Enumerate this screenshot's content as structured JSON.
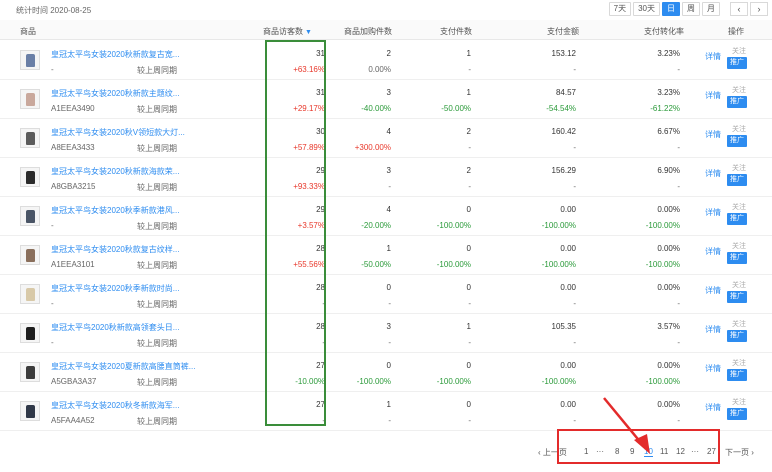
{
  "header": {
    "stat_time": "统计时间 2020-08-25",
    "ranges": [
      "7天",
      "30天",
      "日",
      "周",
      "月"
    ],
    "active_range": "日",
    "prev_arrow": "‹",
    "next_arrow": "›"
  },
  "columns": {
    "product": "商品",
    "visitors": "商品访客数",
    "cart": "商品加购件数",
    "pay_count": "支付件数",
    "pay_amount": "支付金额",
    "conversion": "支付转化率",
    "actions": "操作"
  },
  "compare_label": "较上周同期",
  "action_labels": {
    "detail": "详情",
    "follow": "关注",
    "promote": "推广"
  },
  "rows": [
    {
      "title": "皇冠太平鸟女装2020秋新款复古宽...",
      "code": "-",
      "visitors": "31",
      "visitors_chg": "+63.16%",
      "cart": "2",
      "cart_chg": "0.00%",
      "pay_count": "1",
      "pay_count_chg": "-",
      "pay_amount": "153.12",
      "pay_amount_chg": "-",
      "conversion": "3.23%",
      "conversion_chg": "-",
      "thumb_color": "#6a7fa6"
    },
    {
      "title": "皇冠太平鸟女装2020秋新款主题纹...",
      "code": "A1EEA3490",
      "visitors": "31",
      "visitors_chg": "+29.17%",
      "cart": "3",
      "cart_chg": "-40.00%",
      "pay_count": "1",
      "pay_count_chg": "-50.00%",
      "pay_amount": "84.57",
      "pay_amount_chg": "-54.54%",
      "conversion": "3.23%",
      "conversion_chg": "-61.22%",
      "thumb_color": "#c9a89c"
    },
    {
      "title": "皇冠太平鸟女装2020秋V领短款大灯...",
      "code": "A8EEA3433",
      "visitors": "30",
      "visitors_chg": "+57.89%",
      "cart": "4",
      "cart_chg": "+300.00%",
      "pay_count": "2",
      "pay_count_chg": "-",
      "pay_amount": "160.42",
      "pay_amount_chg": "-",
      "conversion": "6.67%",
      "conversion_chg": "-",
      "thumb_color": "#5b5b5b"
    },
    {
      "title": "皇冠太平鸟女装2020秋新款海款荣...",
      "code": "A8GBA3215",
      "visitors": "29",
      "visitors_chg": "+93.33%",
      "cart": "3",
      "cart_chg": "-",
      "pay_count": "2",
      "pay_count_chg": "-",
      "pay_amount": "156.29",
      "pay_amount_chg": "-",
      "conversion": "6.90%",
      "conversion_chg": "-",
      "thumb_color": "#2b2b2b"
    },
    {
      "title": "皇冠太平鸟女装2020秋季新款港风...",
      "code": "-",
      "visitors": "29",
      "visitors_chg": "+3.57%",
      "cart": "4",
      "cart_chg": "-20.00%",
      "pay_count": "0",
      "pay_count_chg": "-100.00%",
      "pay_amount": "0.00",
      "pay_amount_chg": "-100.00%",
      "conversion": "0.00%",
      "conversion_chg": "-100.00%",
      "thumb_color": "#4a5566"
    },
    {
      "title": "皇冠太平鸟女装2020秋款复古纹样...",
      "code": "A1EEA3101",
      "visitors": "28",
      "visitors_chg": "+55.56%",
      "cart": "1",
      "cart_chg": "-50.00%",
      "pay_count": "0",
      "pay_count_chg": "-100.00%",
      "pay_amount": "0.00",
      "pay_amount_chg": "-100.00%",
      "conversion": "0.00%",
      "conversion_chg": "-100.00%",
      "thumb_color": "#8a6f5c"
    },
    {
      "title": "皇冠太平鸟女装2020秋季新款时尚...",
      "code": "-",
      "visitors": "28",
      "visitors_chg": "-",
      "cart": "0",
      "cart_chg": "-",
      "pay_count": "0",
      "pay_count_chg": "-",
      "pay_amount": "0.00",
      "pay_amount_chg": "-",
      "conversion": "0.00%",
      "conversion_chg": "-",
      "thumb_color": "#d8c9a8"
    },
    {
      "title": "皇冠太平鸟2020秋新款高领套头日...",
      "code": "-",
      "visitors": "28",
      "visitors_chg": "-",
      "cart": "3",
      "cart_chg": "-",
      "pay_count": "1",
      "pay_count_chg": "-",
      "pay_amount": "105.35",
      "pay_amount_chg": "-",
      "conversion": "3.57%",
      "conversion_chg": "-",
      "thumb_color": "#1e1e1e"
    },
    {
      "title": "皇冠太平鸟女装2020夏新款高腰直筒裤...",
      "code": "A5GBA3A37",
      "visitors": "27",
      "visitors_chg": "-10.00%",
      "cart": "0",
      "cart_chg": "-100.00%",
      "pay_count": "0",
      "pay_count_chg": "-100.00%",
      "pay_amount": "0.00",
      "pay_amount_chg": "-100.00%",
      "conversion": "0.00%",
      "conversion_chg": "-100.00%",
      "thumb_color": "#3c3c3c"
    },
    {
      "title": "皇冠太平鸟女装2020秋冬新款海军...",
      "code": "A5FAA4A52",
      "visitors": "27",
      "visitors_chg": "-",
      "cart": "1",
      "cart_chg": "-",
      "pay_count": "0",
      "pay_count_chg": "-",
      "pay_amount": "0.00",
      "pay_amount_chg": "-",
      "conversion": "0.00%",
      "conversion_chg": "-",
      "thumb_color": "#303848"
    }
  ],
  "pagination": {
    "prev": "‹ 上一页",
    "pages": [
      "1",
      "···",
      "8",
      "9",
      "10",
      "11",
      "12",
      "···",
      "27"
    ],
    "current": "10",
    "next": "下一页 ›"
  },
  "colors": {
    "accent": "#2d8cf0",
    "increase": "#e8382b",
    "decrease": "#2b9a3a",
    "highlight_box": "#3a8d3a",
    "annotation": "#e32b2b"
  },
  "icons": {
    "sort": "sort-down-icon",
    "arrow_prev": "chevron-left-icon",
    "arrow_next": "chevron-right-icon"
  }
}
